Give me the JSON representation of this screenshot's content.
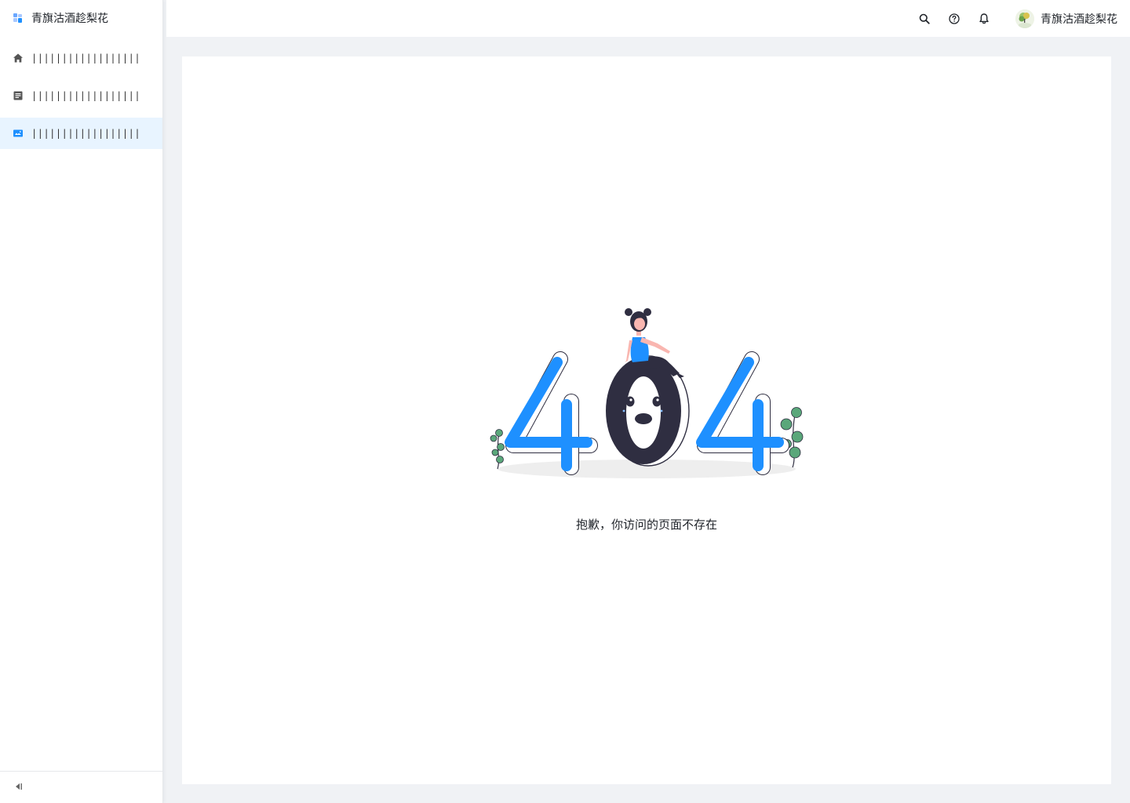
{
  "app": {
    "brand_title": "青旗沽酒趁梨花"
  },
  "sidebar": {
    "items": [
      {
        "icon": "home-icon",
        "label": "||||||||||||||||||",
        "active": false
      },
      {
        "icon": "document-icon",
        "label": "||||||||||||||||||",
        "active": false
      },
      {
        "icon": "image-icon",
        "label": "||||||||||||||||||",
        "active": true
      }
    ],
    "collapse_icon": "collapse-sidebar-icon"
  },
  "header": {
    "icons": [
      "search-icon",
      "help-icon",
      "bell-icon"
    ],
    "user_name": "青旗沽酒趁梨花"
  },
  "main": {
    "illustration_text": "404",
    "message": "抱歉，你访问的页面不存在"
  },
  "colors": {
    "accent": "#1e90ff",
    "active_bg": "#e8f4ff",
    "dark": "#2f2e41",
    "plant": "#5aa77a"
  }
}
